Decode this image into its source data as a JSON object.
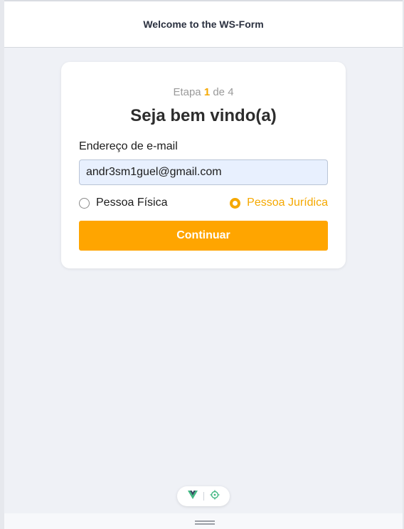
{
  "header": {
    "title": "Welcome to the WS-Form"
  },
  "form": {
    "step": {
      "prefix": "Etapa",
      "current": "1",
      "separator": "de",
      "total": "4"
    },
    "heading": "Seja bem vindo(a)",
    "email_label": "Endereço de e-mail",
    "email_value": "andr3sm1guel@gmail.com",
    "options": [
      {
        "label": "Pessoa Física",
        "selected": false
      },
      {
        "label": "Pessoa Jurídica",
        "selected": true
      }
    ],
    "continue_label": "Continuar"
  },
  "devtools": {
    "icons": [
      "vue-logo-icon",
      "inspector-target-icon"
    ]
  },
  "colors": {
    "accent": "#ffa500",
    "vue_dark": "#35495e",
    "inspector_green": "#42b883"
  }
}
